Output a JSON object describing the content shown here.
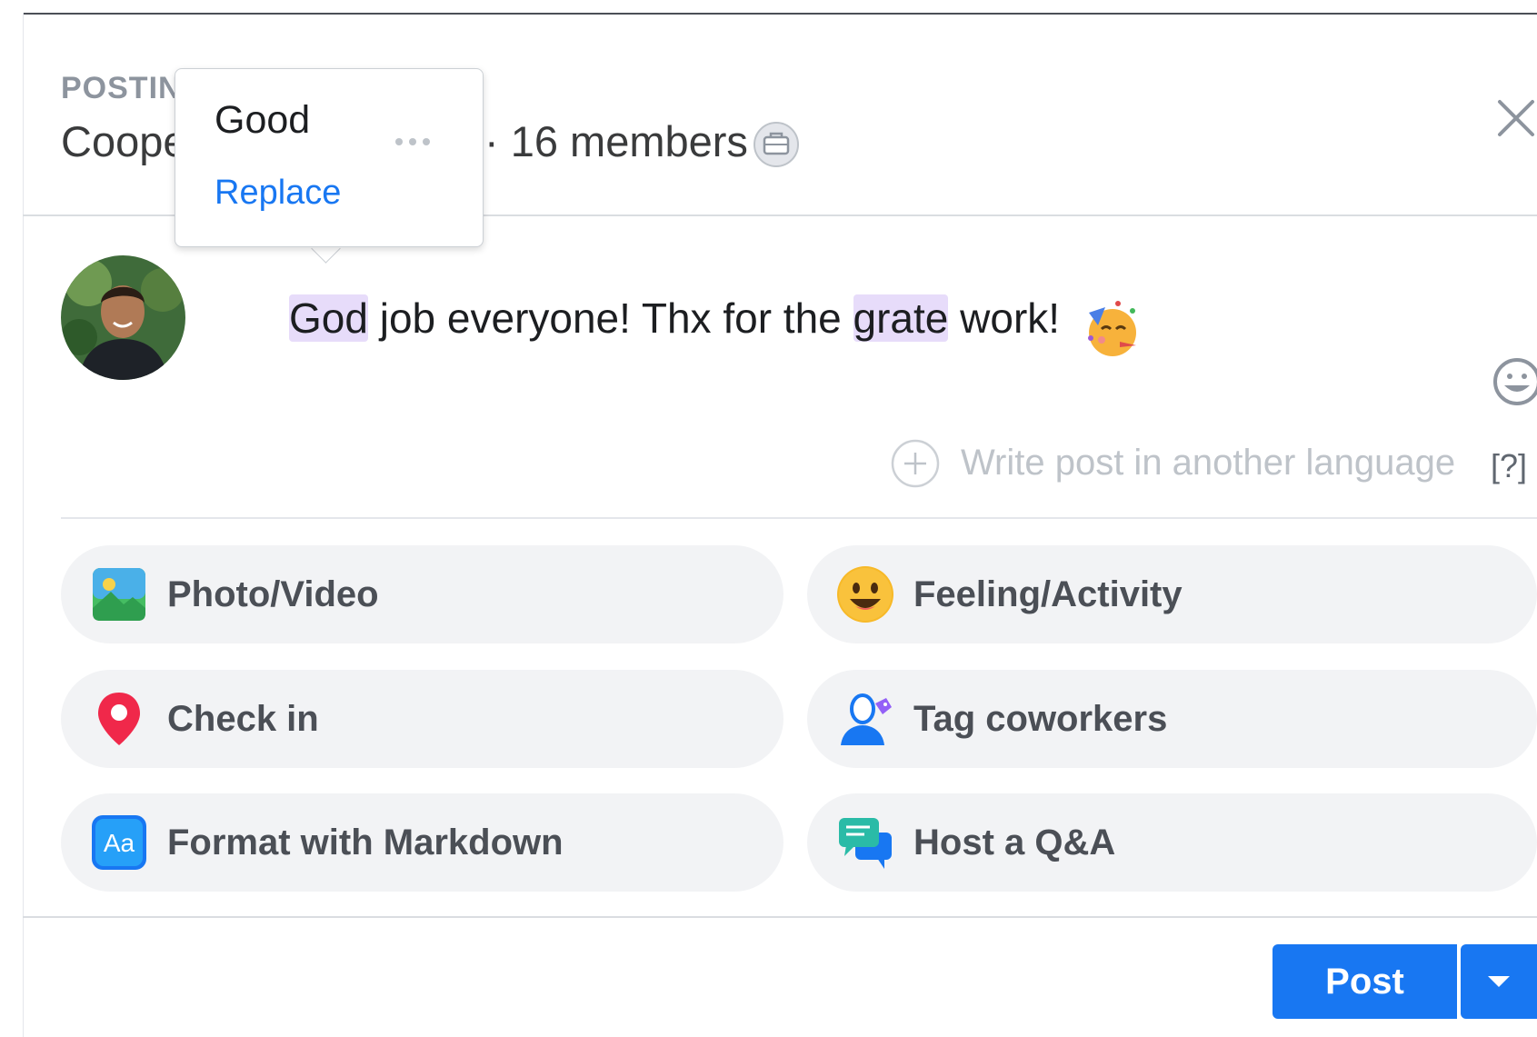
{
  "header": {
    "caption": "POSTIN",
    "group_name": "Coope",
    "members_text": "· 16 members"
  },
  "spelling_popup": {
    "suggestion": "Good",
    "replace_label": "Replace"
  },
  "composer": {
    "post_words": {
      "w1": "God",
      "w2": " job everyone! Thx for the ",
      "w3": "grate",
      "w4": " work!"
    },
    "translate_label": "Write post in another language",
    "translate_help": "[?]"
  },
  "actions": [
    {
      "label": "Photo/Video",
      "icon": "photo-video-icon"
    },
    {
      "label": "Feeling/Activity",
      "icon": "feeling-emoji-icon"
    },
    {
      "label": "Check in",
      "icon": "location-pin-icon"
    },
    {
      "label": "Tag coworkers",
      "icon": "tag-coworkers-icon"
    },
    {
      "label": "Format with Markdown",
      "icon": "markdown-icon"
    },
    {
      "label": "Host a Q&A",
      "icon": "qa-chat-icon"
    }
  ],
  "footer": {
    "post_label": "Post"
  },
  "colors": {
    "accent": "#1877f2",
    "highlight": "#e7dcfa",
    "button_bg": "#f2f3f5"
  }
}
